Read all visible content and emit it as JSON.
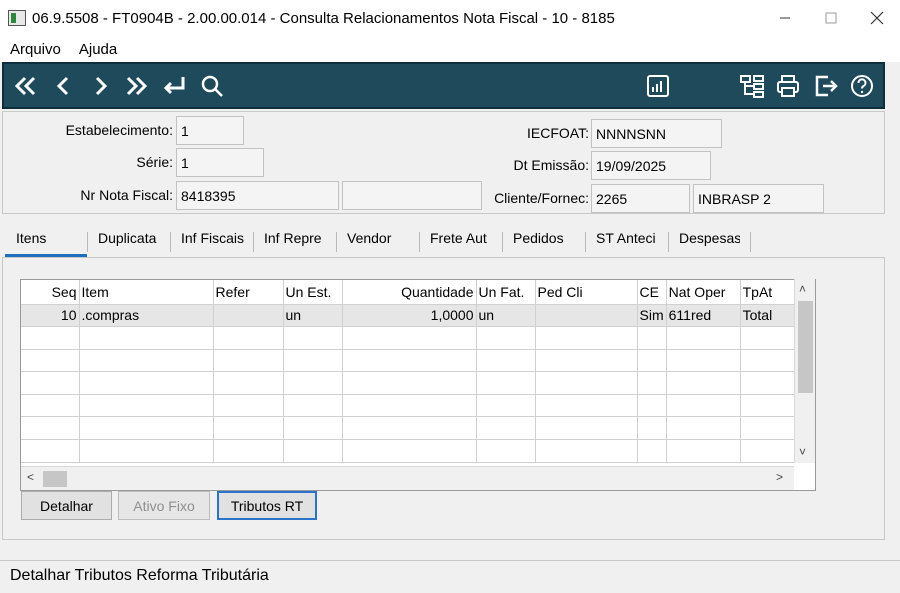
{
  "window": {
    "title": "06.9.5508 - FT0904B - 2.00.00.014 - Consulta Relacionamentos Nota Fiscal - 10 - 8185",
    "controls": [
      "minimize-icon",
      "maximize-icon",
      "close-icon"
    ]
  },
  "menu": [
    "Arquivo",
    "Ajuda"
  ],
  "toolbar": {
    "background": "#1e4a5c",
    "icons": [
      "first-record-icon",
      "previous-record-icon",
      "next-record-icon",
      "last-record-icon",
      "goto-icon",
      "search-icon",
      "report-icon",
      "hierarchy-icon",
      "print-icon",
      "exit-icon",
      "help-icon"
    ]
  },
  "form": {
    "estabelecimento": {
      "label": "Estabelecimento:",
      "value": "1"
    },
    "serie": {
      "label": "Série:",
      "value": "1"
    },
    "nr_nota_fiscal": {
      "label": "Nr Nota Fiscal:",
      "value": "8418395",
      "value2": ""
    },
    "iecfoat": {
      "label": "IECFOAT:",
      "value": "NNNNSNN"
    },
    "dt_emissao": {
      "label": "Dt Emissão:",
      "value": "19/09/2025"
    },
    "cliente": {
      "label": "Cliente/Fornec:",
      "code": "2265",
      "name": "INBRASP  2"
    }
  },
  "tabs": [
    "Itens",
    "Duplicata",
    "Inf Fiscais",
    "Inf Repre",
    "Vendor",
    "Frete Aut",
    "Pedidos",
    "ST Anteci",
    "Despesas"
  ],
  "active_tab": "Itens",
  "grid": {
    "columns": [
      "Seq",
      "Item",
      "Refer",
      "Un Est.",
      "Quantidade",
      "Un Fat.",
      "Ped Cli",
      "CE",
      "Nat Oper",
      "TpAt"
    ],
    "rows": [
      [
        "10",
        ".compras",
        "",
        "un",
        "1,0000",
        "un",
        "",
        "Sim",
        "611red",
        "Total"
      ]
    ]
  },
  "buttons": {
    "detalhar": "Detalhar",
    "ativo_fixo": "Ativo Fixo",
    "tributos_rt": "Tributos RT"
  },
  "status": "Detalhar Tributos Reforma Tributária"
}
